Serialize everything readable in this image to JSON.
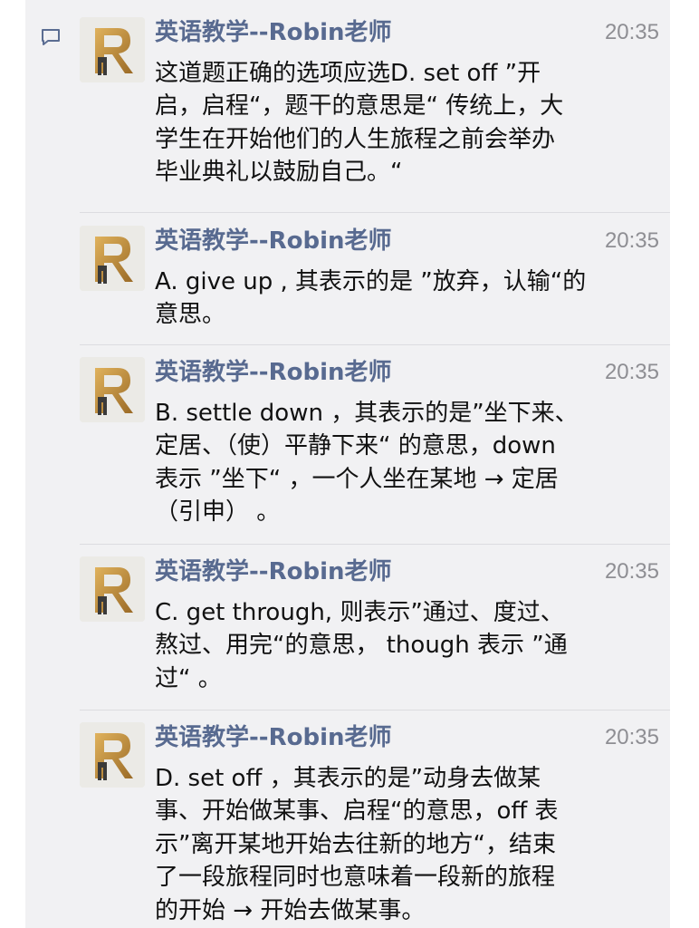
{
  "messages": [
    {
      "sender": "英语教学--Robin老师",
      "time": "20:35",
      "lines": [
        "这道题正确的选项应选D. set off  ”开",
        "启，启程“，题干的意思是“ 传统上，大",
        "学生在开始他们的人生旅程之前会举办",
        "毕业典礼以鼓励自己。“"
      ]
    },
    {
      "sender": "英语教学--Robin老师",
      "time": "20:35",
      "lines": [
        "A. give up , 其表示的是 ”放弃，认输“的",
        "意思。"
      ]
    },
    {
      "sender": "英语教学--Robin老师",
      "time": "20:35",
      "lines": [
        "B. settle down ，其表示的是”坐下来、",
        "定居、（使）平静下来“ 的意思，down",
        "表示 ”坐下“ ，一个人坐在某地 → 定居",
        "（引申） 。"
      ]
    },
    {
      "sender": "英语教学--Robin老师",
      "time": "20:35",
      "lines": [
        "C. get through,  则表示”通过、度过、",
        "熬过、用完“的意思， though 表示 ”通",
        "过“ 。"
      ]
    },
    {
      "sender": "英语教学--Robin老师",
      "time": "20:35",
      "lines": [
        "D. set off ，其表示的是”动身去做某",
        "事、开始做某事、启程“的意思，off 表",
        "示”离开某地开始去往新的地方“，结束",
        "了一段旅程同时也意味着一段新的旅程",
        "的开始 → 开始去做某事。"
      ]
    }
  ],
  "icons": {
    "comment": "comment-icon",
    "avatar": "robin-logo-avatar"
  },
  "colors": {
    "sender": "#586a90",
    "time": "#8e8e93",
    "text": "#111111",
    "panel": "#f1f1f3",
    "separator": "#dcdce0"
  }
}
